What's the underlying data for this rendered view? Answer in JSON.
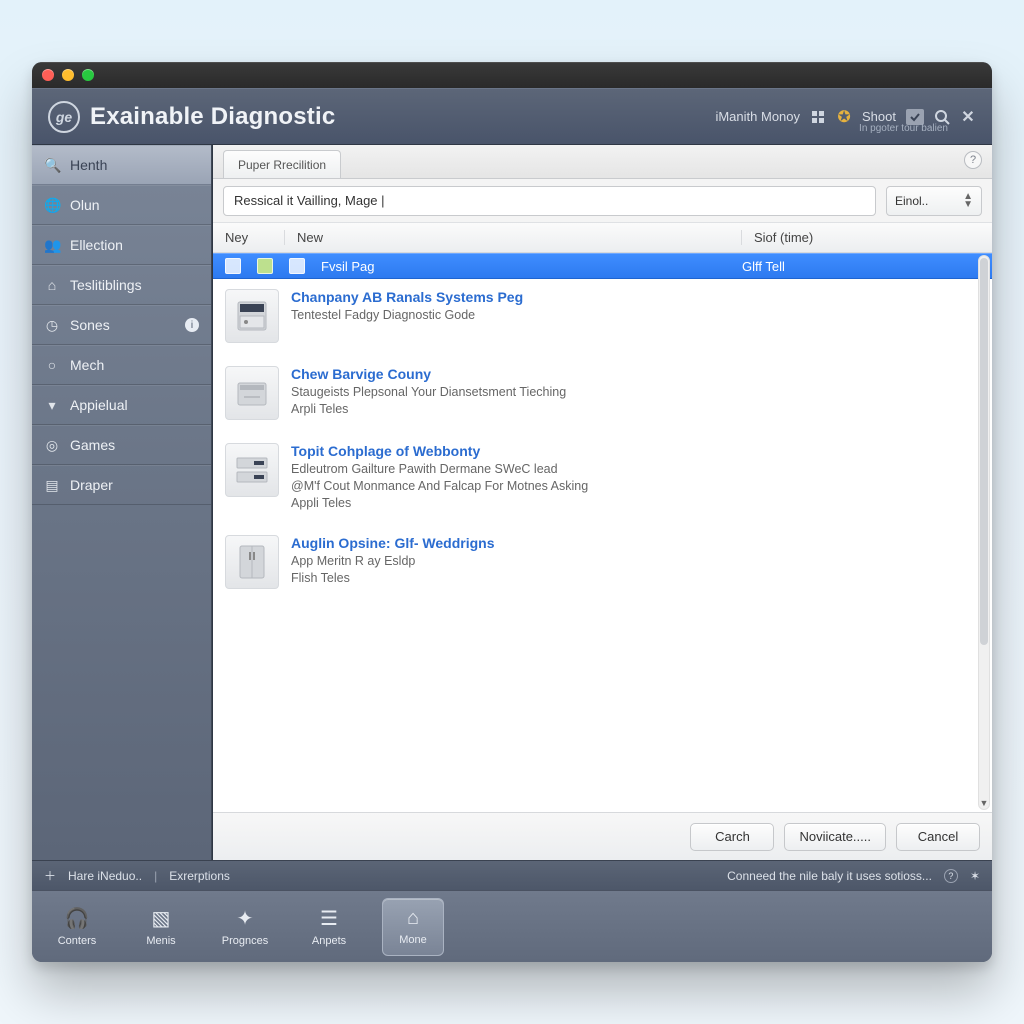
{
  "header": {
    "app_title": "Exainable Diagnostic",
    "subtitle": "In pgoter tour balien",
    "menu_label": "iManith Monoy",
    "shoot_label": "Shoot"
  },
  "sidebar": {
    "items": [
      {
        "icon": "search",
        "label": "Henth"
      },
      {
        "icon": "globe",
        "label": "Olun"
      },
      {
        "icon": "people",
        "label": "Ellection"
      },
      {
        "icon": "home",
        "label": "Teslitiblings"
      },
      {
        "icon": "clock",
        "label": "Sones",
        "badge": "i"
      },
      {
        "icon": "search2",
        "label": "Mech"
      },
      {
        "icon": "down",
        "label": "Appielual"
      },
      {
        "icon": "target",
        "label": "Games"
      },
      {
        "icon": "bar",
        "label": "Draper"
      }
    ]
  },
  "content": {
    "tab_label": "Puper Rrecilition",
    "search_value": "Ressical it Vailling, Mage |",
    "encode_label": "Einol..",
    "columns": {
      "ney": "Ney",
      "new": "New",
      "time": "Siof (time)"
    },
    "selected_row": {
      "title": "Fvsil Pag",
      "time": "Glff Tell"
    },
    "rows": [
      {
        "title": "Chanpany AB Ranals Systems Peg",
        "sub1": "Tentestel Fadgy Diagnostic Gode",
        "sub2": "",
        "sub3": ""
      },
      {
        "title": "Chew Barvige Couny",
        "sub1": "Staugeists Plepsonal Your Diansetsment Tieching",
        "sub2": "",
        "sub3": "Arpli Teles"
      },
      {
        "title": "Topit Cohplage of Webbonty",
        "sub1": "Edleutrom Gailture Pawith Dermane SWeC lead",
        "sub2": "@M'f Cout Monmance And Falcap For Motnes Asking",
        "sub3": "Appli Teles"
      },
      {
        "title": "Auglin Opsine: Glf- Weddrigns",
        "sub1": "App Meritn R ay Esldp",
        "sub2": "",
        "sub3": "Flish Teles"
      }
    ],
    "buttons": {
      "carch": "Carch",
      "novicate": "Noviicate.....",
      "cancel": "Cancel"
    }
  },
  "statusbar": {
    "left1": "Hare iNeduo..",
    "left2": "Exrerptions",
    "right": "Conneed the nile baly it uses sotioss..."
  },
  "dock": {
    "items": [
      {
        "label": "Conters",
        "icon": "headset"
      },
      {
        "label": "Menis",
        "icon": "box"
      },
      {
        "label": "Prognces",
        "icon": "person"
      },
      {
        "label": "Anpets",
        "icon": "list"
      },
      {
        "label": "Mone",
        "icon": "home",
        "active": true
      }
    ]
  }
}
